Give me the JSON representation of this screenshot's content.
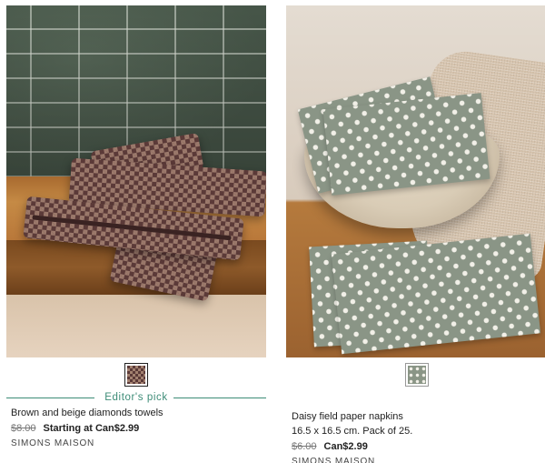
{
  "products": [
    {
      "name": "Brown and beige diamonds towels",
      "badge": "Editor's pick",
      "original_price": "$8.00",
      "price": "Starting at Can$2.99",
      "brand": "SIMONS MAISON",
      "swatch_colors": [
        "#5b3a38",
        "#a2806f"
      ]
    },
    {
      "name": "Daisy field paper napkins",
      "description": "16.5 x 16.5 cm. Pack of 25.",
      "original_price": "$6.00",
      "price": "Can$2.99",
      "brand": "SIMONS MAISON",
      "swatch_colors": [
        "#8a9586",
        "#f2f0e8"
      ]
    }
  ],
  "colors": {
    "accent": "#3d8c77",
    "text": "#222222",
    "muted": "#777777"
  }
}
